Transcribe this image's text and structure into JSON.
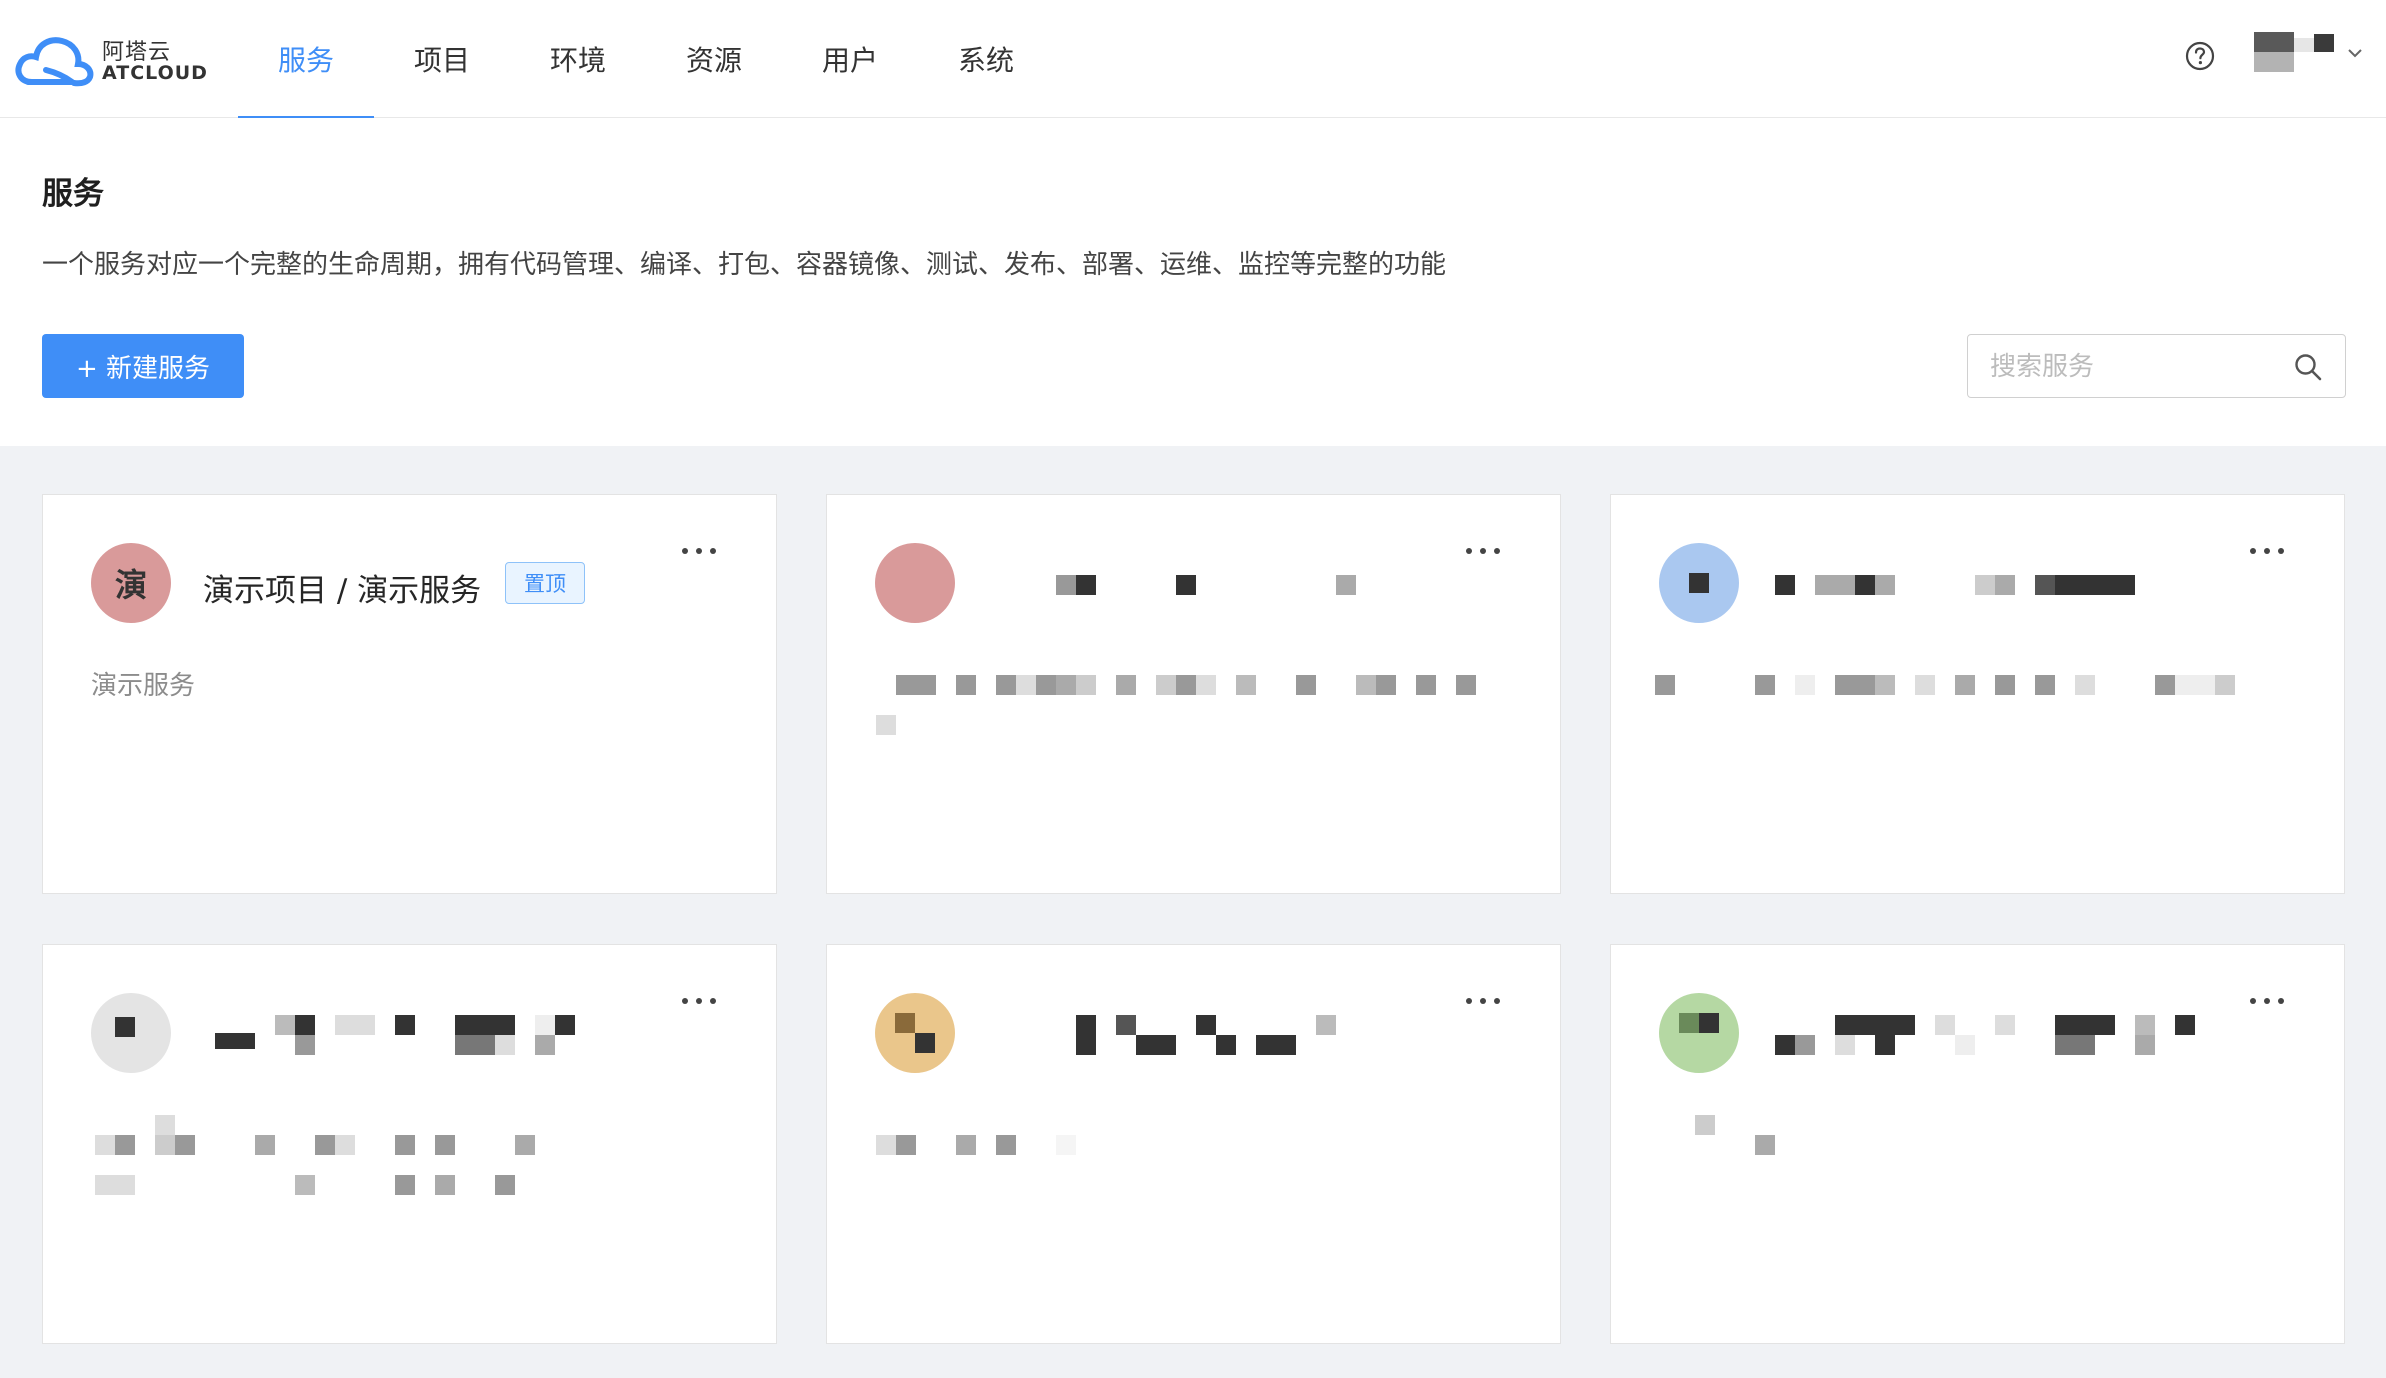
{
  "brand": {
    "name_cn": "阿塔云",
    "name_en": "ATCLOUD",
    "logo_icon": "cloud-logo-icon",
    "accent_color": "#3f8ef7"
  },
  "nav": {
    "items": [
      {
        "label": "服务",
        "active": true
      },
      {
        "label": "项目",
        "active": false
      },
      {
        "label": "环境",
        "active": false
      },
      {
        "label": "资源",
        "active": false
      },
      {
        "label": "用户",
        "active": false
      },
      {
        "label": "系统",
        "active": false
      }
    ]
  },
  "header": {
    "help_icon": "question-circle-icon",
    "caret_icon": "chevron-down-icon"
  },
  "page": {
    "title": "服务",
    "description": "一个服务对应一个完整的生命周期，拥有代码管理、编译、打包、容器镜像、测试、发布、部署、运维、监控等完整的功能",
    "new_button_label": "+ 新建服务",
    "search_placeholder": "搜索服务",
    "search_icon": "search-icon"
  },
  "cards": [
    {
      "avatar_text": "演",
      "avatar_color": "#d99a9a",
      "title": "演示项目 / 演示服务",
      "tag": "置顶",
      "description": "演示服务",
      "redacted": false
    },
    {
      "avatar_text": "",
      "avatar_color": "#d99a9a",
      "title": "",
      "tag": "",
      "description": "",
      "redacted": true
    },
    {
      "avatar_text": "",
      "avatar_color": "#aac8f0",
      "title": "",
      "tag": "",
      "description": "",
      "redacted": true
    },
    {
      "avatar_text": "",
      "avatar_color": "#e4e4e4",
      "title": "",
      "tag": "",
      "description": "",
      "redacted": true
    },
    {
      "avatar_text": "",
      "avatar_color": "#eac68b",
      "title": "",
      "tag": "",
      "description": "",
      "redacted": true
    },
    {
      "avatar_text": "",
      "avatar_color": "#b5d8a3",
      "title": "",
      "tag": "",
      "description": "",
      "redacted": true
    }
  ]
}
